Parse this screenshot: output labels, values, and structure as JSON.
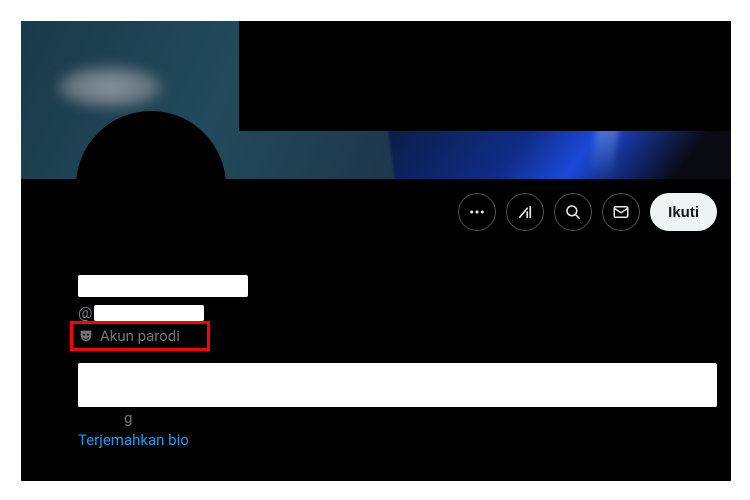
{
  "profile": {
    "handle_prefix": "@",
    "parody_label": "Akun parodi",
    "translate_label": "Terjemahkan bio",
    "bio_visible_tail": "g"
  },
  "actions": {
    "follow_label": "Ikuti"
  },
  "icons": {
    "more": "more-icon",
    "grok": "grok-icon",
    "search": "search-icon",
    "message": "message-icon",
    "mask": "parody-mask-icon"
  },
  "colors": {
    "accent": "#1d9bf0",
    "bg": "#000000",
    "text_muted": "#71767b",
    "highlight": "#ff0000",
    "follow_bg": "#eff3f4"
  }
}
